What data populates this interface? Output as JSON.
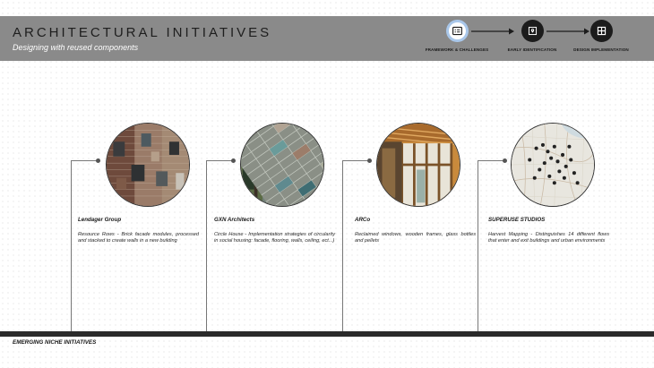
{
  "header": {
    "title": "ARCHITECTURAL INITIATIVES",
    "subtitle": "Designing with reused components"
  },
  "steps": [
    {
      "label": "FRAMEWORK & CHALLENGES",
      "icon": "framework-icon",
      "active": true
    },
    {
      "label": "EARLY IDENTIFICATION",
      "icon": "map-pin-icon",
      "active": false
    },
    {
      "label": "DESIGN IMPLEMENTATION",
      "icon": "grid-window-icon",
      "active": false
    }
  ],
  "initiatives": [
    {
      "name": "Lendager Group",
      "description": "Resource Rows - Brick facade modules, processed and stacked to create walls in a new building"
    },
    {
      "name": "GXN Architects",
      "description": "Circle House - Implementation strategies of circularity in social housing: facade, flooring, walls, ceiling, ect...)"
    },
    {
      "name": "ARCo",
      "description": "Reclaimed windows, wooden frames, glass bottles and pellets"
    },
    {
      "name": "SUPERUSE STUDIOS",
      "description": "Harvest Mapping - Distinguishes 14 different flows that enter and exit buildings and urban environments"
    }
  ],
  "footer": {
    "label": "EMERGING NICHE INITIATIVES"
  },
  "colors": {
    "header_bg": "#8a8a8a",
    "active_ring": "#a9c7ea",
    "dark": "#1c1c1c"
  }
}
